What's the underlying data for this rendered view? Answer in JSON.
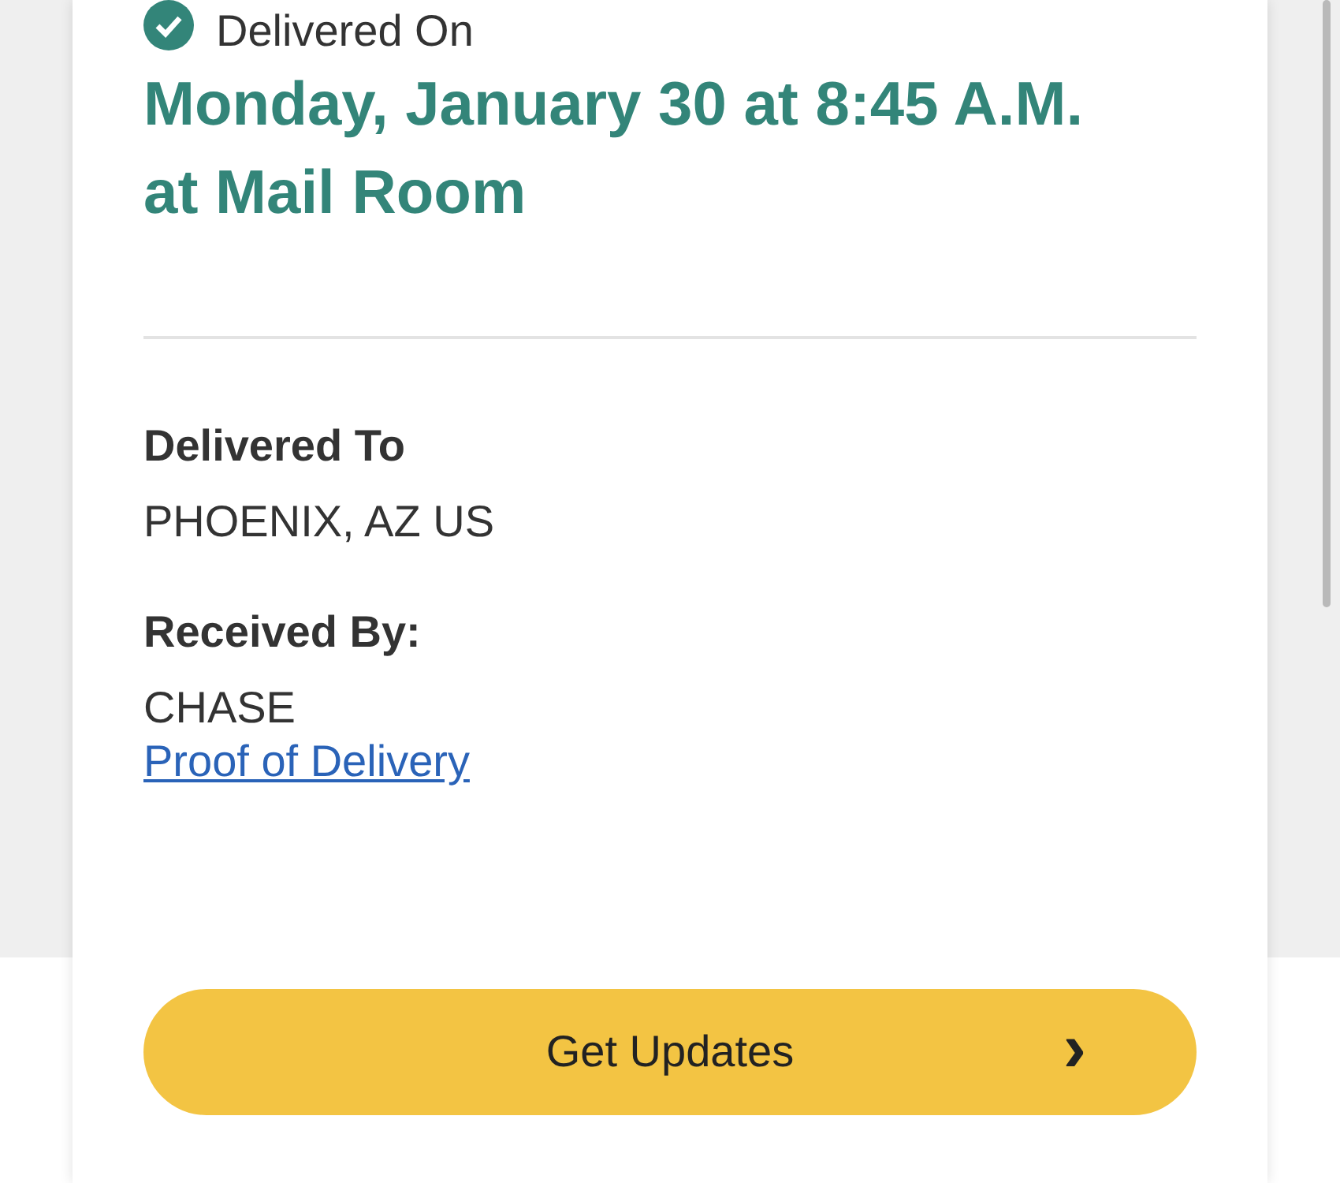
{
  "delivery": {
    "status_label": "Delivered On",
    "status_checked": true,
    "headline": "Monday, January 30 at 8:45 A.M. at Mail Room"
  },
  "details": [
    {
      "label": "Delivered To",
      "value": "PHOENIX, AZ US"
    },
    {
      "label": "Received By:",
      "value": "CHASE",
      "link": "Proof of Delivery"
    }
  ],
  "button": {
    "label": "Get Updates",
    "icon": "›"
  }
}
